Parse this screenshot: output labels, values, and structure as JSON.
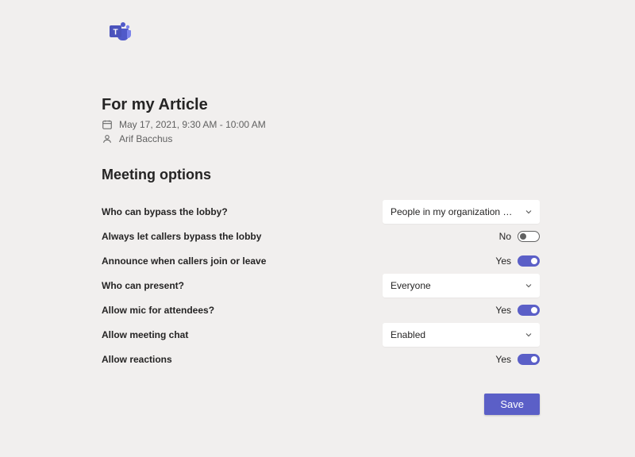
{
  "meeting": {
    "title": "For my Article",
    "datetime": "May 17, 2021, 9:30 AM - 10:00 AM",
    "organizer": "Arif Bacchus"
  },
  "section_title": "Meeting options",
  "options": {
    "bypass_lobby": {
      "label": "Who can bypass the lobby?",
      "value": "People in my organization and gu..."
    },
    "callers_bypass": {
      "label": "Always let callers bypass the lobby",
      "value": "No",
      "state": "off"
    },
    "announce": {
      "label": "Announce when callers join or leave",
      "value": "Yes",
      "state": "on"
    },
    "present": {
      "label": "Who can present?",
      "value": "Everyone"
    },
    "mic": {
      "label": "Allow mic for attendees?",
      "value": "Yes",
      "state": "on"
    },
    "chat": {
      "label": "Allow meeting chat",
      "value": "Enabled"
    },
    "reactions": {
      "label": "Allow reactions",
      "value": "Yes",
      "state": "on"
    }
  },
  "buttons": {
    "save": "Save"
  }
}
